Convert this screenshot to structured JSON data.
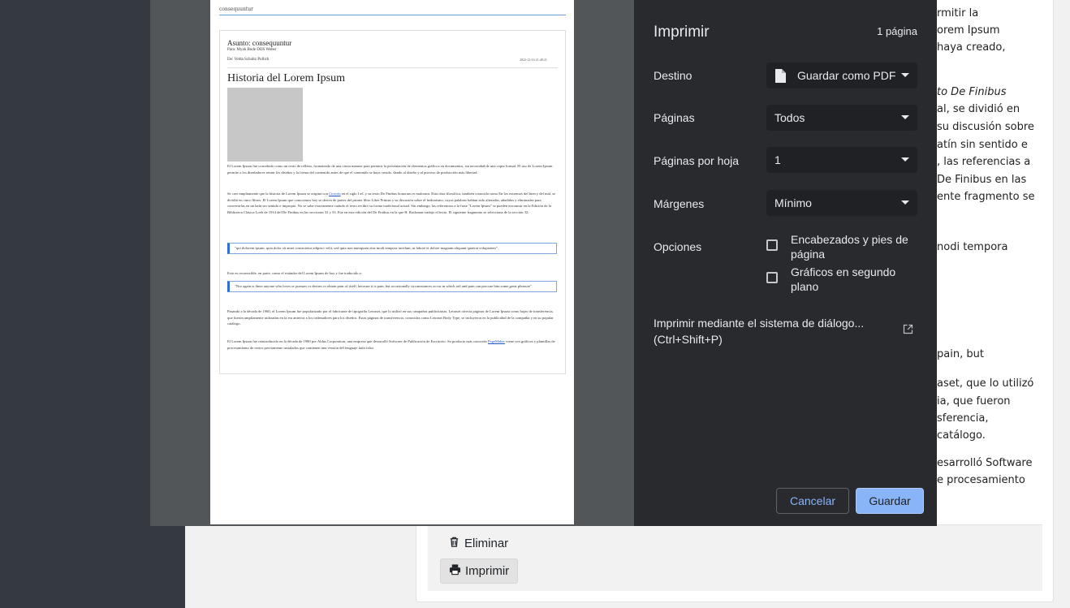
{
  "background": {
    "text_lines": [
      "rmitir la",
      "orem Ipsum",
      "haya creado,",
      "",
      "to De Finibus",
      "al, se dividió en",
      "su discusión sobre",
      "atín sin sentido e",
      ", las referencias a",
      " De Finibus en las",
      "ente fragmento se",
      "nodi tempora",
      "pain, but",
      "aset, que lo utilizó",
      "ia, que fueron",
      "sferencia,",
      "catálogo.",
      "esarrolló Software",
      "e procesamiento"
    ],
    "delete_label": "Eliminar",
    "print_label": "Imprimir"
  },
  "print_dialog": {
    "title": "Imprimir",
    "page_count": "1 página",
    "destination_label": "Destino",
    "destination_value": "Guardar como PDF",
    "pages_label": "Páginas",
    "pages_value": "Todos",
    "pages_per_sheet_label": "Páginas por hoja",
    "pages_per_sheet_value": "1",
    "margins_label": "Márgenes",
    "margins_value": "Mínimo",
    "options_label": "Opciones",
    "option_headers": "Encabezados y pies de página",
    "option_background": "Gráficos en segundo plano",
    "system_dialog": "Imprimir mediante el sistema de diálogo... (Ctrl+Shift+P)",
    "cancel_label": "Cancelar",
    "save_label": "Guardar"
  },
  "preview": {
    "header": "consequuntur",
    "subject": "Asunto: consequuntur",
    "to": "Para: Myah Bode DDS Weber",
    "from": "De: Velda Schultz Pollich",
    "date": "2022-12-16 21:48:21",
    "title": "Historia del Lorem Ipsum",
    "p1": "El Lorem Ipsum fue concebido como un texto de relleno, formateado de una cierta manera para permitir la presentación de elementos gráficos en documentos, sin necesidad de una copia formal. El uso de Lorem Ipsum permite a los diseñadores reunir los diseños y la forma del contenido antes de que el contenido se haya creado, dando al diseño y al proceso de producción más libertad.",
    "p2_a": "Se cree ampliamente que la historia de Lorem Ipsum se origina con ",
    "p2_link": "Cicerón",
    "p2_b": " en el siglo I aC y su texto De Finibus bonorum et malorum. Esta obra filosófica, también conocida como En los extremos del bien y del mal, se dividió en cinco libros. El Lorem Ipsum que conocemos hoy se deriva de partes del primer libro Liber Primus y su discusión sobre el hedonismo, cuyas palabras habían sido alteradas, añadidas y eliminadas para convertirlas en un latín sin sentido e impropio. No se sabe exactamente cuándo el texto recibió su forma tradicional actual. Sin embargo, las referencias a la frase \"Lorem Ipsum\" se pueden encontrar en la Edición de la Biblioteca Clásica Loeb de 1914 del De Finibus en las secciones 32 y 33. Fue en esta edición del De Finibus en la que H. Rackman tradujo el texto. El siguiente fragmento se selecciona de la sección 32:",
    "quote1": "\"qui dolorem ipsum, quia dolor sit amet consectetur adipisci velit, sed quia non numquam eius modi tempora incidunt, ut labore et dolore magnam aliquam quaerat voluptatem\".",
    "p3": "Esto es reconocible, en parte, como el estándar del Lorem Ipsum de hoy y fue traducido a:",
    "quote2": "\"Nor again is there anyone who loves or pursues or desires to obtain pain of itself, because it is pain, but occasionally circumstances occur in which toil and pain can procure him some great pleasure\".",
    "p4": "Pasando a la década de 1960, el Lorem Ipsum fue popularizado por el fabricante de tipografía Letraset, que lo utilizó en sus campañas publicitarias. Letraset ofrecía páginas de Lorem Ipsum como hojas de transferencia, que fueron ampliamente utilizadas en la era anterior a los ordenadores para los diseños. Estas páginas de transferencia, conocidas como Letraset Body Type, se incluyeron en la publicidad de la compañía y en su popular catálogo.",
    "p5_a": "El Lorem Ipsum fue reintroducido en la década de 1980 por Aldus Corporation, una empresa que desarrolló Software de Publicación de Escritorio. Su producto más conocido ",
    "p5_link": "PageMaker",
    "p5_b": " viene con gráficos y plantillas de procesamiento de textos previamente instalados que contienen una versión del lenguaje latín falso."
  }
}
